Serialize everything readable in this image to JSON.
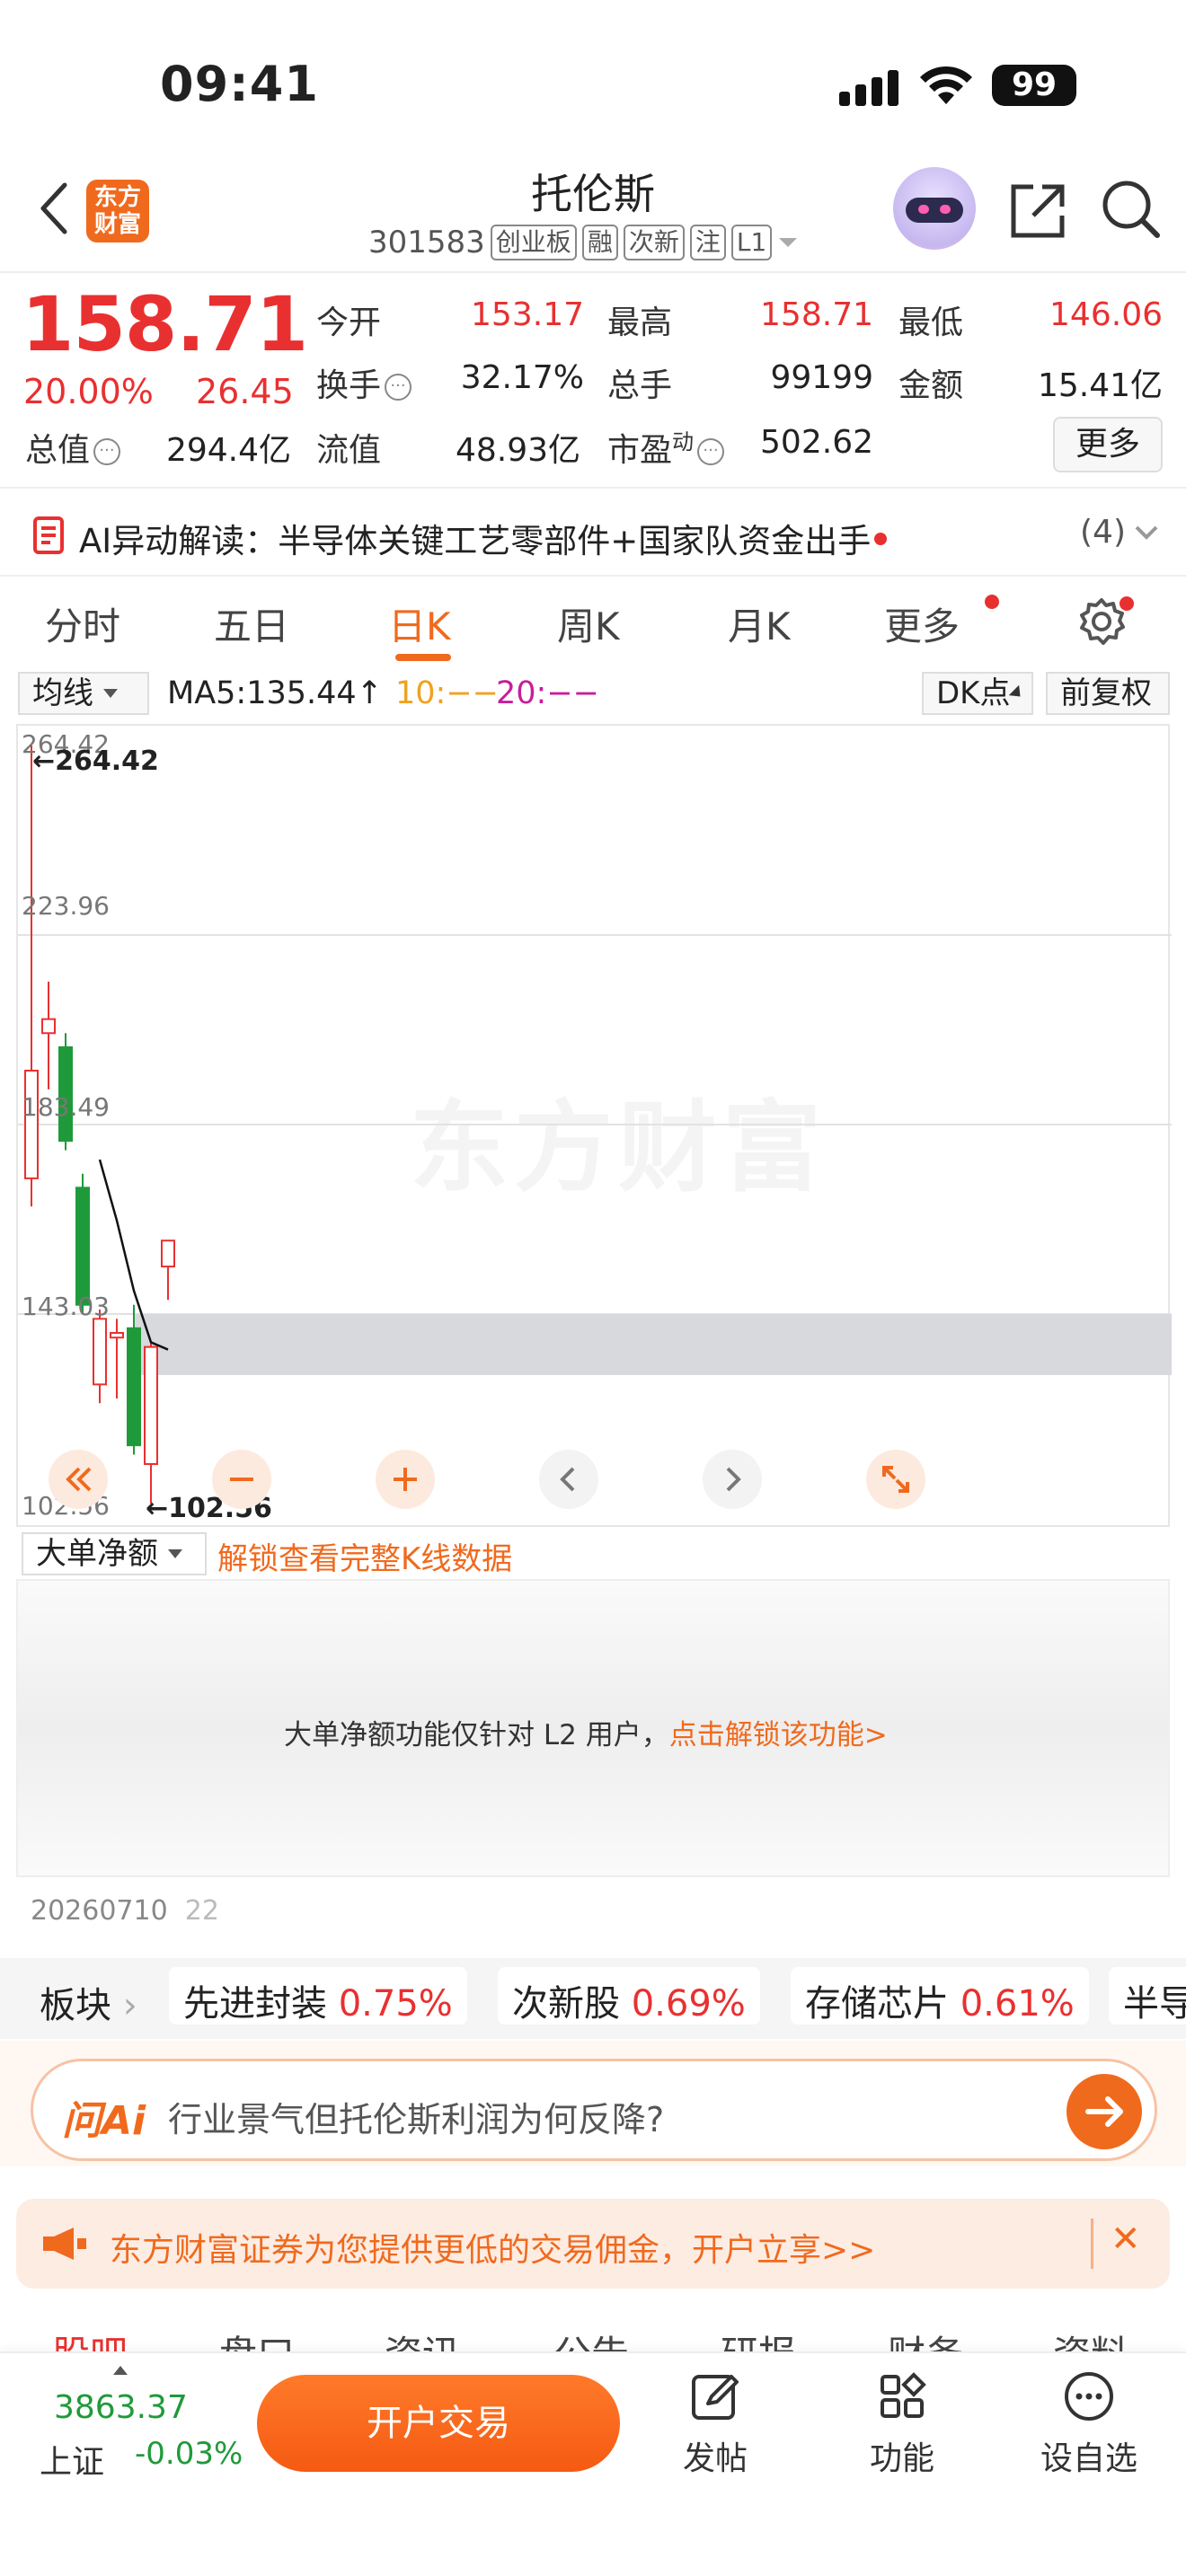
{
  "status_bar": {
    "time": "09:41",
    "battery": "99"
  },
  "header": {
    "logo": "东方\n财富",
    "stock_name": "托伦斯",
    "stock_code": "301583",
    "tags": [
      "创业板",
      "融",
      "次新",
      "注",
      "L1"
    ]
  },
  "quote": {
    "price": "158.71",
    "change_pct": "20.00%",
    "change_abs": "26.45",
    "fields": [
      {
        "label": "今开",
        "value": "153.17",
        "color": "red"
      },
      {
        "label": "最高",
        "value": "158.71",
        "color": "red"
      },
      {
        "label": "最低",
        "value": "146.06",
        "color": "red"
      },
      {
        "label": "换手",
        "value": "32.17%",
        "color": "black"
      },
      {
        "label": "总手",
        "value": "99199",
        "color": "black"
      },
      {
        "label": "金额",
        "value": "15.41亿",
        "color": "black"
      },
      {
        "label": "总值",
        "value": "294.4亿",
        "color": "black"
      },
      {
        "label": "流值",
        "value": "48.93亿",
        "color": "black"
      },
      {
        "label": "市盈",
        "value": "502.62",
        "color": "black"
      }
    ],
    "pe_superscript": "动",
    "more_label": "更多"
  },
  "ai_banner": {
    "text": "AI异动解读：半导体关键工艺零部件+国家队资金出手",
    "count": "(4)"
  },
  "tabs": [
    "分时",
    "五日",
    "日K",
    "周K",
    "月K",
    "更多"
  ],
  "active_tab": "日K",
  "ma_bar": {
    "indicator": "均线",
    "ma5": "MA5:135.44↑",
    "ma10": "10:−−",
    "ma20": "20:−−",
    "dk": "DK点",
    "adjust": "前复权"
  },
  "chart": {
    "axis_labels": [
      "264.42",
      "223.96",
      "183.49",
      "143.03",
      "102.56"
    ],
    "high_label": "←264.42",
    "low_label": "←102.56",
    "watermark": "东方财富"
  },
  "chart_data": {
    "type": "candlestick",
    "ylim": [
      102.56,
      264.42
    ],
    "candles": [
      {
        "open": 172,
        "high": 264.42,
        "low": 166,
        "close": 195,
        "direction": "up"
      },
      {
        "open": 203,
        "high": 214,
        "low": 191,
        "close": 206,
        "direction": "up"
      },
      {
        "open": 200,
        "high": 203,
        "low": 178,
        "close": 180,
        "direction": "down"
      },
      {
        "open": 170,
        "high": 173,
        "low": 143,
        "close": 145,
        "direction": "down"
      },
      {
        "open": 128,
        "high": 144,
        "low": 124,
        "close": 142,
        "direction": "up"
      },
      {
        "open": 138,
        "high": 142,
        "low": 125,
        "close": 139,
        "direction": "up"
      },
      {
        "open": 140,
        "high": 145,
        "low": 113,
        "close": 115,
        "direction": "down"
      },
      {
        "open": 111,
        "high": 137,
        "low": 102.56,
        "close": 136,
        "direction": "up"
      },
      {
        "open": 153.17,
        "high": 158.71,
        "low": 146.06,
        "close": 158.71,
        "direction": "up"
      }
    ],
    "ma5": [
      null,
      null,
      null,
      null,
      176,
      163,
      148,
      137,
      135.44
    ],
    "shaded_band": [
      130,
      143
    ]
  },
  "big_order": {
    "indicator": "大单净额",
    "unlock_link": "解锁查看完整K线数据",
    "lock_message": "大单净额功能仅针对 L2 用户，",
    "lock_link": "点击解锁该功能>",
    "date": "20260710",
    "date_suffix": "22"
  },
  "sector": {
    "label": "板块",
    "items": [
      {
        "name": "先进封装",
        "change": "0.75%"
      },
      {
        "name": "次新股",
        "change": "0.69%"
      },
      {
        "name": "存储芯片",
        "change": "0.61%"
      },
      {
        "name": "半导",
        "change": ""
      }
    ]
  },
  "ask_ai": {
    "logo": "问Ai",
    "question": "行业景气但托伦斯利润为何反降?"
  },
  "promo": {
    "text": "东方财富证券为您提供更低的交易佣金，开户立享>>"
  },
  "bottom_tabs": [
    "股吧",
    "盘口",
    "资讯",
    "公告",
    "研报",
    "财务",
    "资料"
  ],
  "bottom_bar": {
    "index_value": "3863.37",
    "index_name": "上证",
    "index_change": "-0.03%",
    "trade_button": "开户交易",
    "nav": [
      "发帖",
      "功能",
      "设自选"
    ]
  }
}
